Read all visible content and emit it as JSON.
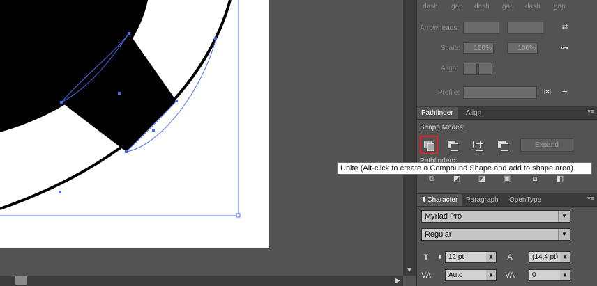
{
  "stroke_panel": {
    "dash_gap_labels": [
      "dash",
      "gap",
      "dash",
      "gap",
      "dash",
      "gap"
    ],
    "arrowheads_label": "Arrowheads:",
    "scale_label": "Scale:",
    "scale_start": "100%",
    "scale_end": "100%",
    "align_label": "Align:",
    "profile_label": "Profile:"
  },
  "pathfinder_panel": {
    "tabs": [
      "Pathfinder",
      "Align"
    ],
    "shape_modes_label": "Shape Modes:",
    "pathfinders_label": "Pathfinders:",
    "expand_label": "Expand",
    "tooltip": "Unite (Alt-click to create a Compound Shape and add to shape area)"
  },
  "character_panel": {
    "tabs": [
      "Character",
      "Paragraph",
      "OpenType"
    ],
    "font_family": "Myriad Pro",
    "font_style": "Regular",
    "font_size": "12 pt",
    "leading": "(14,4 pt)",
    "kerning": "Auto",
    "tracking": "0"
  },
  "colors": {
    "highlight": "#e0202a",
    "selection": "#4a6cf0",
    "panel_bg": "#535353"
  }
}
